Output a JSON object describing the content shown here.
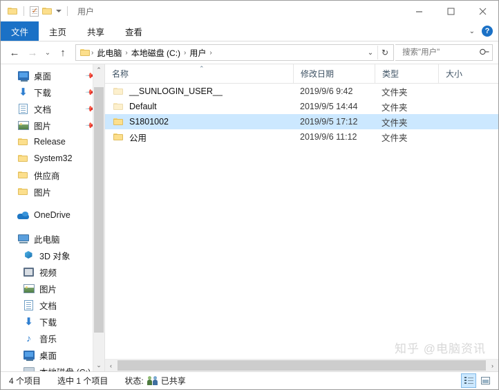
{
  "window": {
    "title": "用户",
    "quick_access_icons": [
      "folder-icon",
      "properties-icon",
      "new-folder-icon"
    ],
    "minimize_label": "—",
    "maximize_label": "□",
    "close_label": "✕"
  },
  "ribbon": {
    "tabs": [
      {
        "label": "文件",
        "active": true
      },
      {
        "label": "主页",
        "active": false
      },
      {
        "label": "共享",
        "active": false
      },
      {
        "label": "查看",
        "active": false
      }
    ],
    "expand_label": "⌄",
    "help_label": "?"
  },
  "address": {
    "back_label": "←",
    "forward_label": "→",
    "recent_label": "⌄",
    "up_label": "↑",
    "crumbs": [
      "此电脑",
      "本地磁盘 (C:)",
      "用户"
    ],
    "separator": "›",
    "dropdown_label": "⌄",
    "refresh_label": "↻"
  },
  "search": {
    "placeholder": "搜索\"用户\"",
    "value": "",
    "icon": "search-icon"
  },
  "sidebar": {
    "quick_access": [
      {
        "label": "桌面",
        "icon": "desktop-icon",
        "pinned": true
      },
      {
        "label": "下载",
        "icon": "download-icon",
        "pinned": true
      },
      {
        "label": "文档",
        "icon": "documents-icon",
        "pinned": true
      },
      {
        "label": "图片",
        "icon": "pictures-icon",
        "pinned": true
      },
      {
        "label": "Release",
        "icon": "folder-icon",
        "pinned": false
      },
      {
        "label": "System32",
        "icon": "folder-icon",
        "pinned": false
      },
      {
        "label": "供应商",
        "icon": "folder-icon",
        "pinned": false
      },
      {
        "label": "图片",
        "icon": "folder-icon",
        "pinned": false
      }
    ],
    "onedrive": {
      "label": "OneDrive",
      "icon": "onedrive-icon"
    },
    "this_pc": {
      "label": "此电脑",
      "icon": "this-pc-icon"
    },
    "this_pc_children": [
      {
        "label": "3D 对象",
        "icon": "3d-objects-icon"
      },
      {
        "label": "视频",
        "icon": "videos-icon"
      },
      {
        "label": "图片",
        "icon": "pictures-icon"
      },
      {
        "label": "文档",
        "icon": "documents-icon"
      },
      {
        "label": "下载",
        "icon": "download-icon"
      },
      {
        "label": "音乐",
        "icon": "music-icon"
      },
      {
        "label": "桌面",
        "icon": "desktop-icon"
      },
      {
        "label": "本地磁盘 (C:)",
        "icon": "drive-icon"
      }
    ],
    "scroll_up_label": "⌃",
    "scroll_down_label": "⌄"
  },
  "filelist": {
    "columns": [
      {
        "key": "name",
        "label": "名称",
        "sorted": "asc",
        "sort_caret": "⌃"
      },
      {
        "key": "date",
        "label": "修改日期",
        "sorted": "",
        "sort_caret": ""
      },
      {
        "key": "type",
        "label": "类型",
        "sorted": "",
        "sort_caret": ""
      },
      {
        "key": "size",
        "label": "大小",
        "sorted": "",
        "sort_caret": ""
      }
    ],
    "rows": [
      {
        "name": "__SUNLOGIN_USER__",
        "date": "2019/9/6 9:42",
        "type": "文件夹",
        "size": "",
        "selected": false,
        "hidden": true
      },
      {
        "name": "Default",
        "date": "2019/9/5 14:44",
        "type": "文件夹",
        "size": "",
        "selected": false,
        "hidden": true
      },
      {
        "name": "S1801002",
        "date": "2019/9/5 17:12",
        "type": "文件夹",
        "size": "",
        "selected": true,
        "hidden": false
      },
      {
        "name": "公用",
        "date": "2019/9/6 11:12",
        "type": "文件夹",
        "size": "",
        "selected": false,
        "hidden": false
      }
    ],
    "hscroll_left_label": "‹",
    "hscroll_right_label": "›"
  },
  "statusbar": {
    "item_count": "4 个项目",
    "selection": "选中 1 个项目",
    "status_label": "状态:",
    "share_text": "已共享",
    "share_icon": "shared-people-icon",
    "view_details_label": "details-view-icon",
    "view_icons_label": "large-icons-view-icon"
  },
  "watermark": {
    "text": "知乎 @电脑资讯"
  },
  "colors": {
    "accent": "#1b71c6",
    "selection": "#cce8ff",
    "folder": "#fcdf8d"
  }
}
